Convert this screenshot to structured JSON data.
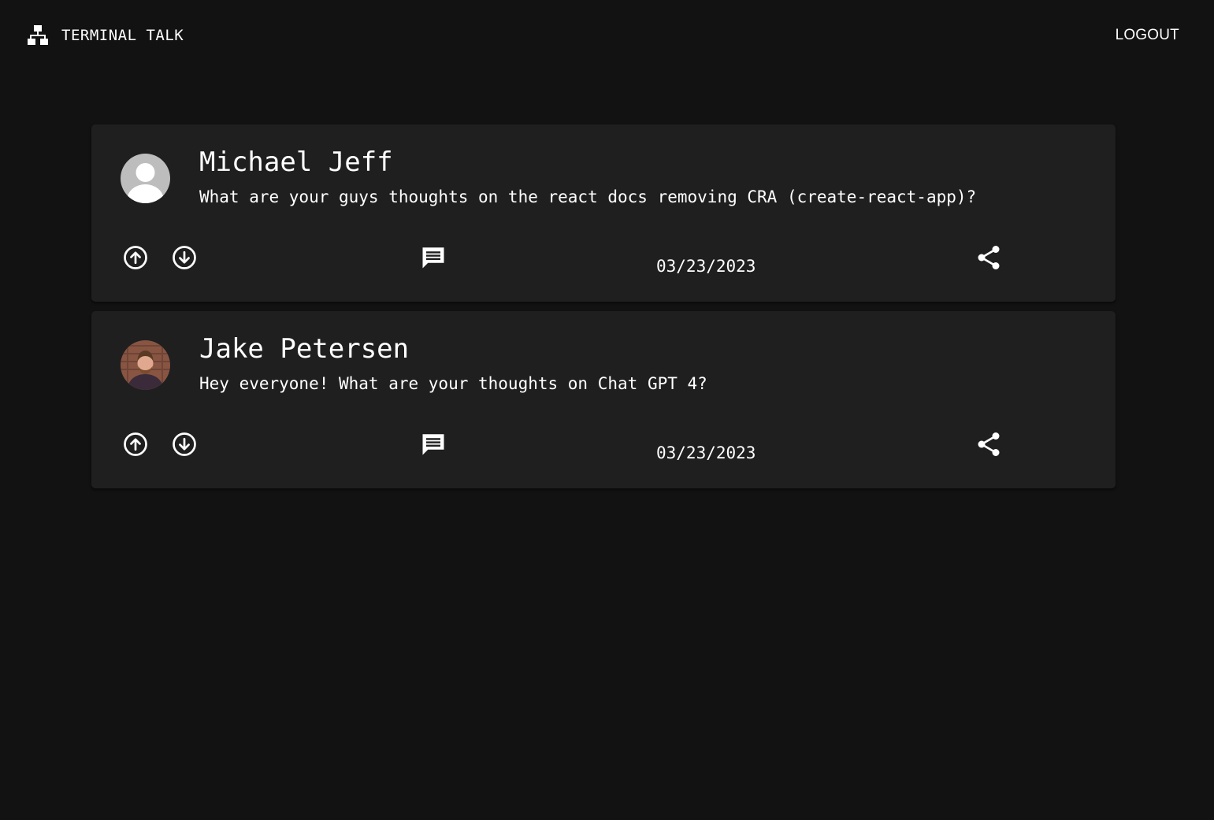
{
  "app": {
    "title": "TERMINAL TALK",
    "logout_label": "LOGOUT"
  },
  "posts": [
    {
      "author": "Michael Jeff",
      "content": "What are your guys thoughts on the react docs removing CRA (create-react-app)?",
      "date": "03/23/2023",
      "avatar": "default-avatar"
    },
    {
      "author": "Jake Petersen",
      "content": "Hey everyone! What are your thoughts on Chat GPT 4?",
      "date": "03/23/2023",
      "avatar": "profile-photo"
    }
  ],
  "icons": {
    "brand": "sitemap-icon",
    "upvote": "arrow-circle-up-icon",
    "downvote": "arrow-circle-down-icon",
    "comment": "comment-icon",
    "share": "share-icon"
  },
  "colors": {
    "background": "#121212",
    "card": "#1f1f1f",
    "text": "#ffffff",
    "avatar_default_bg": "#bdbdbd"
  }
}
